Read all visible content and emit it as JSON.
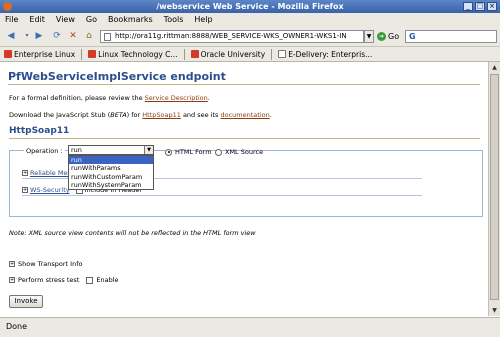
{
  "window": {
    "title": "/webservice Web Service - Mozilla Firefox"
  },
  "menubar": {
    "items": [
      "File",
      "Edit",
      "View",
      "Go",
      "Bookmarks",
      "Tools",
      "Help"
    ]
  },
  "navbar": {
    "url": "http://ora11g.rittman:8888/WEB_SERVICE-WKS_OWNER1-WKS1-IN",
    "go_label": "Go",
    "search_value": "G"
  },
  "bookmarks": [
    "Enterprise Linux",
    "Linux Technology C...",
    "Oracle University",
    "E-Delivery: Enterpris..."
  ],
  "page": {
    "heading": "PfWebServiceImplService endpoint",
    "definition_text": "For a formal definition, please review the ",
    "service_description_link": "Service Description",
    "definition_end": ".",
    "download_text": "Download the JavaScript Stub (",
    "beta": "BETA",
    "download_mid": ") for ",
    "httpsoap_link": "HttpSoap11",
    "download_and": " and see its ",
    "documentation_link": "documentation",
    "download_end": ".",
    "section_title": "HttpSoap11",
    "operation_label": "Operation :",
    "operation_selected": "run",
    "operation_options": [
      "run",
      "runWithParams",
      "runWithCustomParam",
      "runWithSystemParam"
    ],
    "radio_html": "HTML Form",
    "radio_xml": "XML Source",
    "reliable_label": "Reliable Mes",
    "ws_security_label": "WS-Security",
    "include_header": "Include In Header",
    "note": "Note: XML source view contents will not be reflected in the HTML form view",
    "show_transport": "Show Transport Info",
    "stress_test": "Perform stress test",
    "enable_label": "Enable",
    "invoke_label": "Invoke"
  },
  "status": {
    "text": "Done"
  },
  "colors": {
    "titlebar": "#3a62a8",
    "heading": "#2b4f8e",
    "link": "#8a3d12",
    "selection": "#3b63c2"
  }
}
